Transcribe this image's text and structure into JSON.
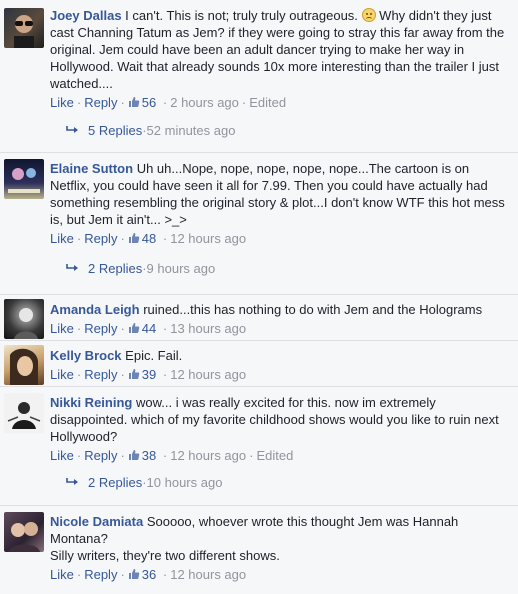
{
  "comments": [
    {
      "author": "Joey Dallas",
      "text_a": "I can't. This is not; truly truly outrageous.",
      "text_b": "Why didn't they just cast Channing Tatum as Jem? if they were going to stray this far away from the original. Jem could have been an adult dancer trying to make her way in Hollywood. Wait that already sounds 10x more interesting than the trailer I just watched....",
      "like": "Like",
      "reply": "Reply",
      "likes": "56",
      "time": "2 hours ago",
      "edited": "Edited",
      "replies_label": "5 Replies",
      "replies_time": "52 minutes ago"
    },
    {
      "author": "Elaine Sutton",
      "text": "Uh uh...Nope, nope, nope, nope, nope...The cartoon is on Netflix, you could have seen it all for 7.99. Then you could have actually had something resembling the original story & plot...I don't know WTF this hot mess is, but Jem it ain't... >_>",
      "like": "Like",
      "reply": "Reply",
      "likes": "48",
      "time": "12 hours ago",
      "replies_label": "2 Replies",
      "replies_time": "9 hours ago"
    },
    {
      "author": "Amanda Leigh",
      "text": "ruined...this has nothing to do with Jem and the Holograms",
      "like": "Like",
      "reply": "Reply",
      "likes": "44",
      "time": "13 hours ago"
    },
    {
      "author": "Kelly Brock",
      "text": "Epic. Fail.",
      "like": "Like",
      "reply": "Reply",
      "likes": "39",
      "time": "12 hours ago"
    },
    {
      "author": "Nikki Reining",
      "text": "wow... i was really excited for this. now im extremely disappointed. which of my favorite childhood shows would you like to ruin next Hollywood?",
      "like": "Like",
      "reply": "Reply",
      "likes": "38",
      "time": "12 hours ago",
      "edited": "Edited",
      "replies_label": "2 Replies",
      "replies_time": "10 hours ago"
    },
    {
      "author": "Nicole Damiata",
      "text": "Sooooo, whoever wrote this thought Jem was Hannah Montana?",
      "text_2": "Silly writers, they're two different shows.",
      "like": "Like",
      "reply": "Reply",
      "likes": "36",
      "time": "12 hours ago"
    }
  ],
  "colors": {
    "link": "#365899",
    "meta": "#90949c",
    "text": "#1d2129",
    "background": "#f6f7f9"
  },
  "icons": {
    "like": "thumbs-up-icon",
    "reply": "reply-arrow-icon",
    "emoji": "frown-emoji-icon"
  }
}
